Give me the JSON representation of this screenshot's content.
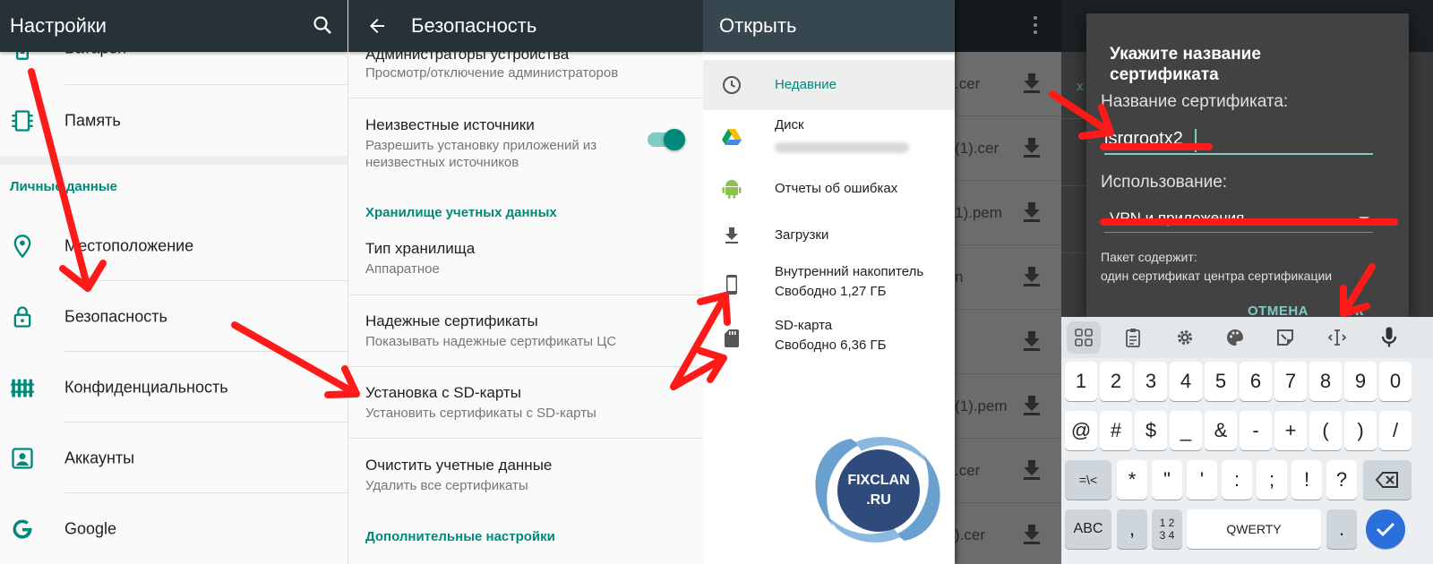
{
  "settings": {
    "title": "Настройки",
    "battery_label": "Батарея",
    "memory_label": "Память",
    "personal_section": "Личные данные",
    "items": [
      {
        "label": "Местоположение"
      },
      {
        "label": "Безопасность"
      },
      {
        "label": "Конфиденциальность"
      },
      {
        "label": "Аккаунты"
      },
      {
        "label": "Google"
      }
    ]
  },
  "security": {
    "title": "Безопасность",
    "device_admins": {
      "title": "Администраторы устройства",
      "subtitle": "Просмотр/отключение администраторов"
    },
    "unknown_sources": {
      "title": "Неизвестные источники",
      "subtitle_line1": "Разрешить установку приложений из",
      "subtitle_line2": "неизвестных источников",
      "enabled": true
    },
    "credential_storage_section": "Хранилище учетных данных",
    "storage_type": {
      "title": "Тип хранилища",
      "subtitle": "Аппаратное"
    },
    "trusted_certs": {
      "title": "Надежные сертификаты",
      "subtitle": "Показывать надежные сертификаты ЦС"
    },
    "install_from_sd": {
      "title": "Установка с SD-карты",
      "subtitle": "Установить сертификаты с SD-карты"
    },
    "clear_credentials": {
      "title": "Очистить учетные данные",
      "subtitle": "Удалить все сертификаты"
    },
    "advanced_section": "Дополнительные настройки"
  },
  "open": {
    "title": "Открыть",
    "items": [
      {
        "label": "Недавние",
        "icon": "clock-icon"
      },
      {
        "label": "Диск",
        "icon": "drive-icon"
      },
      {
        "label": "Отчеты об ошибках",
        "icon": "android-icon"
      },
      {
        "label": "Загрузки",
        "icon": "download-icon"
      },
      {
        "label": "Внутренний накопитель",
        "sub": "Свободно 1,27 ГБ",
        "icon": "phone-icon"
      },
      {
        "label": "SD-карта",
        "sub": "Свободно 6,36 ГБ",
        "icon": "sd-card-icon"
      }
    ],
    "files": [
      ".cer",
      "(1).cer",
      "1).pem",
      "n",
      "",
      "(1).pem",
      ".cer",
      ").cer"
    ]
  },
  "watermark": {
    "line1": "FIXCLAN",
    "line2": ".RU"
  },
  "dialog": {
    "title": "Укажите название сертификата",
    "name_label": "Название сертификата:",
    "name_value": "isrgrootx2",
    "usage_label": "Использование:",
    "usage_value": "VPN и приложения",
    "package_label": "Пакет содержит:",
    "package_value": "один сертификат центра сертификации",
    "cancel": "ОТМЕНА",
    "ok": "ОК"
  },
  "keyboard": {
    "row1": [
      "1",
      "2",
      "3",
      "4",
      "5",
      "6",
      "7",
      "8",
      "9",
      "0"
    ],
    "row2": [
      "@",
      "#",
      "$",
      "_",
      "&",
      "-",
      "+",
      "(",
      ")",
      "/"
    ],
    "row3": [
      "=\\<",
      "*",
      "\"",
      "'",
      ":",
      ";",
      "!",
      "?"
    ],
    "abc": "ABC",
    "comma": ",",
    "numpad_top": "1 2",
    "numpad_bottom": "3 4",
    "space": "QWERTY",
    "period": "."
  },
  "colors": {
    "appbar": "#263238",
    "accent": "#00897b",
    "arrow": "#ff1a1a"
  }
}
